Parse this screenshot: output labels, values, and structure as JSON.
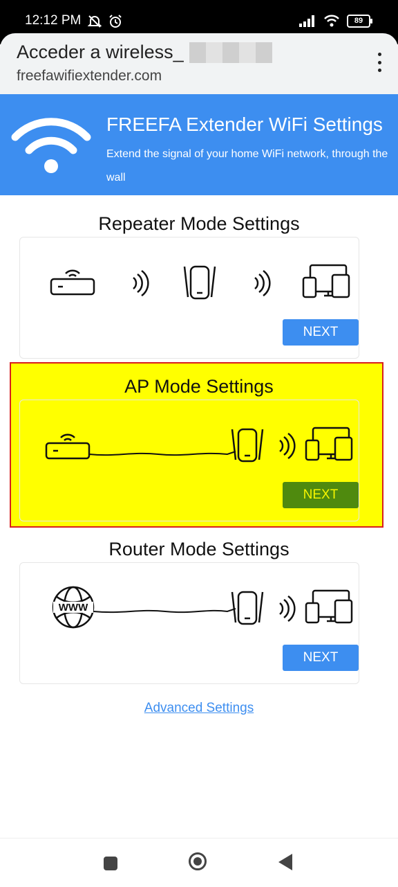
{
  "status": {
    "time": "12:12 PM",
    "battery": "89"
  },
  "browser": {
    "page_title": "Acceder a wireless_",
    "domain": "freefawifiextender.com"
  },
  "banner": {
    "title": "FREEFA Extender WiFi Settings",
    "subtitle": "Extend the signal of your home WiFi network, through the wall"
  },
  "sections": [
    {
      "title": "Repeater Mode Settings",
      "button": "NEXT"
    },
    {
      "title": "AP Mode Settings",
      "button": "NEXT"
    },
    {
      "title": "Router Mode Settings",
      "button": "NEXT"
    }
  ],
  "diagram_labels": {
    "www": "WWW"
  },
  "advanced_link": "Advanced Settings",
  "colors": {
    "accent": "#3d8ef0",
    "highlight": "#ffff00",
    "highlight_border": "#d81e1e",
    "selected_button": "#4f8a0e"
  }
}
